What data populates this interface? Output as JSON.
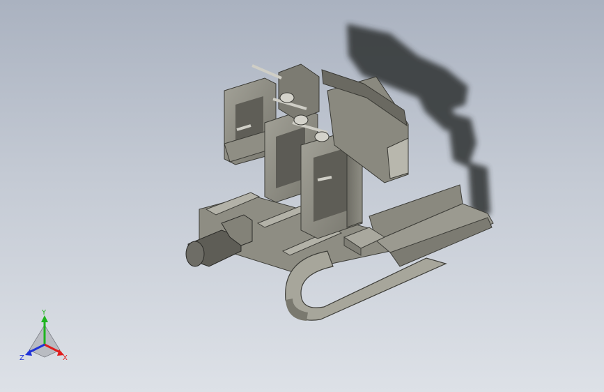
{
  "view": {
    "background_top": "#aab2c0",
    "background_bottom": "#dde1e7",
    "model_color": "#8d8c82",
    "shadow_color": "#2f3133"
  },
  "triad": {
    "x_label": "X",
    "y_label": "Y",
    "z_label": "Z",
    "x_color": "#e01e1e",
    "y_color": "#1fb41f",
    "z_color": "#2033d8"
  }
}
